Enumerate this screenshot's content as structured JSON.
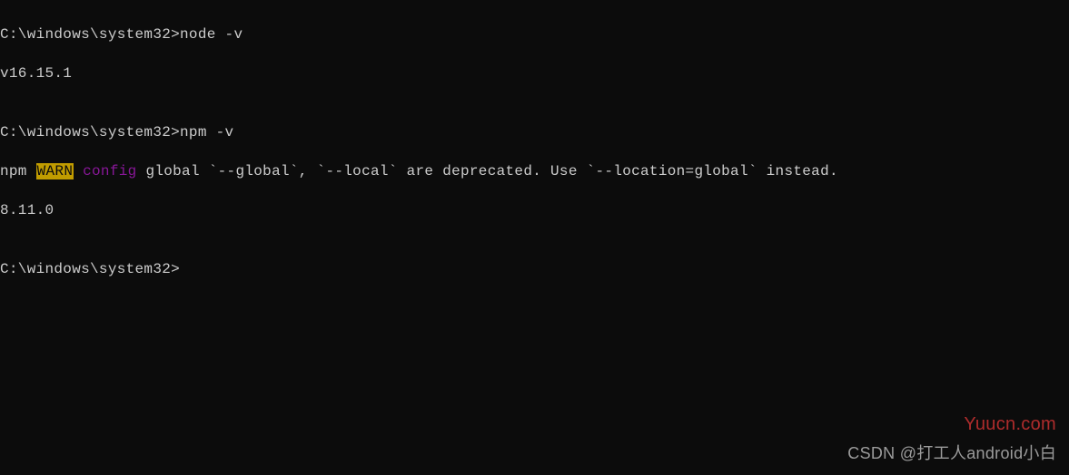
{
  "terminal": {
    "line1_prompt": "C:\\windows\\system32>node -v",
    "line2_output": "v16.15.1",
    "line3_blank": "",
    "line4_prompt": "C:\\windows\\system32>npm -v",
    "line5_npm_prefix": "npm ",
    "line5_warn": "WARN",
    "line5_space": " ",
    "line5_config": "config",
    "line5_rest": " global `--global`, `--local` are deprecated. Use `--location=global` instead.",
    "line6_output": "8.11.0",
    "line7_blank": "",
    "line8_prompt": "C:\\windows\\system32>"
  },
  "watermark": {
    "red": "Yuucn.com",
    "gray": "CSDN @打工人android小白"
  }
}
